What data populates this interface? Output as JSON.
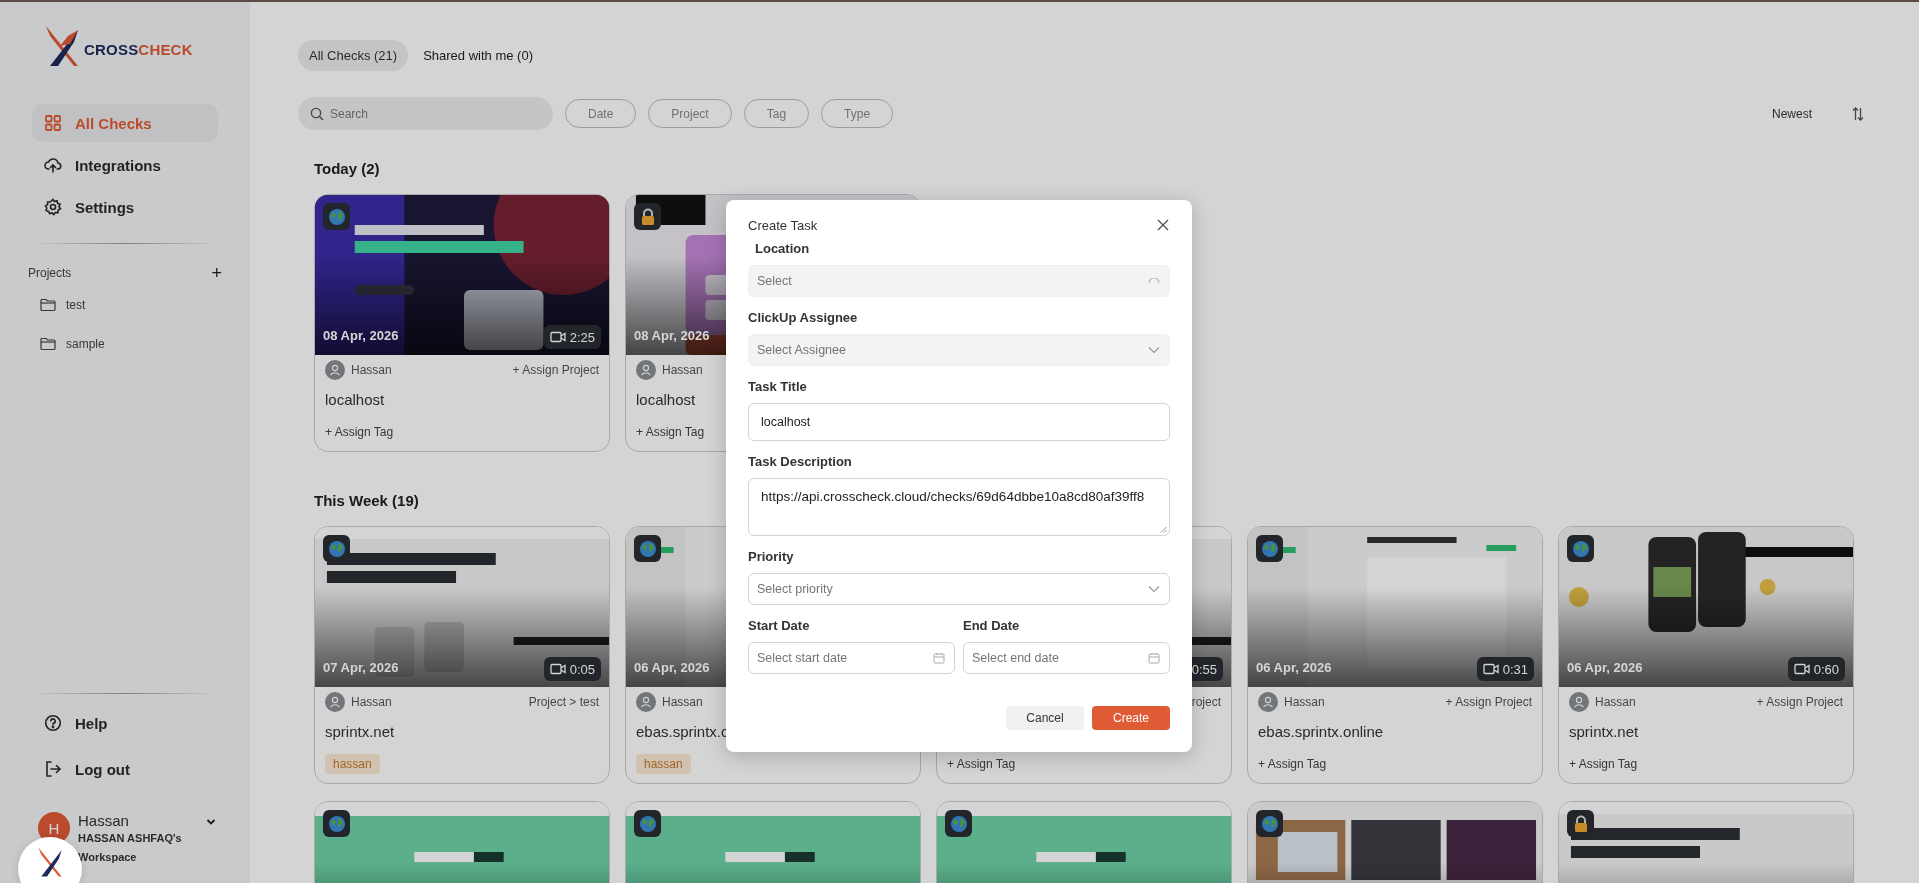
{
  "sidebar": {
    "logo": {
      "part_1": "CROSS",
      "part_2": "CHECK"
    },
    "nav": [
      {
        "label": "All Checks",
        "selected": true
      },
      {
        "label": "Integrations",
        "selected": false
      },
      {
        "label": "Settings",
        "selected": false
      }
    ],
    "projects": {
      "heading": "Projects",
      "add": "+",
      "items": [
        {
          "name": "test"
        },
        {
          "name": "sample"
        }
      ]
    },
    "bottom_nav": [
      {
        "label": "Help"
      },
      {
        "label": "Log out"
      }
    ],
    "user": {
      "initial": "H",
      "name": "Hassan",
      "workspace": "HASSAN ASHFAQ's Workspace"
    }
  },
  "tabs": [
    {
      "label": "All Checks (21)",
      "selected": true
    },
    {
      "label": "Shared with me (0)",
      "selected": false
    }
  ],
  "search": {
    "placeholder": "Search"
  },
  "filters": [
    "Date",
    "Project",
    "Tag",
    "Type"
  ],
  "sort": {
    "label": "Newest"
  },
  "groups": [
    {
      "title": "Today (2)",
      "cards": [
        {
          "locked": false,
          "date": "08 Apr, 2026",
          "duration": "2:25",
          "author": "Hassan",
          "project": "+ Assign Project",
          "title": "localhost",
          "assign_tag": "+ Assign Tag"
        },
        {
          "locked": true,
          "date": "08 Apr, 2026",
          "author": "Hassan",
          "title": "localhost",
          "assign_tag": "+ Assign Tag"
        }
      ]
    },
    {
      "title": "This Week (19)",
      "cards": [
        {
          "locked": false,
          "date": "07 Apr, 2026",
          "duration": "0:05",
          "author": "Hassan",
          "project": "Project > test",
          "title": "sprintx.net",
          "tags": [
            "hassan"
          ]
        },
        {
          "locked": false,
          "date": "06 Apr, 2026",
          "author": "Hassan",
          "title": "ebas.sprintx.c",
          "tags": [
            "hassan"
          ]
        },
        {
          "duration": "0:55",
          "project": "roject",
          "assign_tag": "+ Assign Tag"
        },
        {
          "locked": false,
          "date": "06 Apr, 2026",
          "duration": "0:31",
          "author": "Hassan",
          "project": "+ Assign Project",
          "title": "ebas.sprintx.online",
          "assign_tag": "+ Assign Tag"
        },
        {
          "locked": false,
          "date": "06 Apr, 2026",
          "duration": "0:60",
          "author": "Hassan",
          "project": "+ Assign Project",
          "title": "sprintx.net",
          "assign_tag": "+ Assign Tag"
        },
        {
          "locked": false
        },
        {
          "locked": false
        },
        {
          "locked": false
        },
        {
          "locked": false
        },
        {
          "locked": true
        }
      ]
    }
  ],
  "modal": {
    "title": "Create Task",
    "fields": [
      {
        "kind": "select",
        "label": "Location",
        "placeholder": "Select",
        "disabled": true,
        "loading": true
      },
      {
        "kind": "select",
        "label": "ClickUp Assignee",
        "placeholder": "Select Assignee",
        "disabled": true,
        "loading": false
      },
      {
        "kind": "text",
        "label": "Task Title",
        "value": "localhost"
      },
      {
        "kind": "textarea",
        "label": "Task Description",
        "value": "https://api.crosscheck.cloud/checks/69d64dbbe10a8cd80af39ff8"
      },
      {
        "kind": "select",
        "label": "Priority",
        "placeholder": "Select priority",
        "disabled": false,
        "loading": false
      },
      {
        "kind": "date",
        "label": "Start Date",
        "placeholder": "Select start date"
      },
      {
        "kind": "date",
        "label": "End Date",
        "placeholder": "Select end date"
      }
    ],
    "buttons": [
      {
        "label": "Cancel",
        "kind": "secondary"
      },
      {
        "label": "Create",
        "kind": "primary"
      }
    ]
  }
}
